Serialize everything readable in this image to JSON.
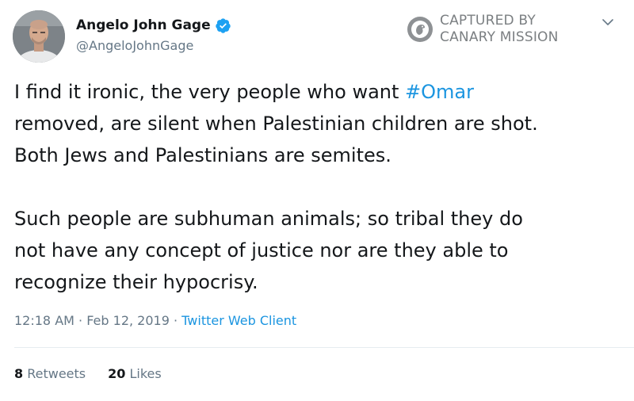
{
  "author": {
    "display_name": "Angelo John Gage",
    "handle": "@AngeloJohnGage",
    "verified": true
  },
  "watermark": {
    "line1": "CAPTURED BY",
    "line2": "CANARY MISSION"
  },
  "tweet": {
    "p1_before": "I find it ironic, the very people who want ",
    "hashtag": "#Omar",
    "p1_line2": "removed, are silent when Palestinian children are shot.",
    "p1_line3": "Both Jews and Palestinians are semites.",
    "p2_line1": "Such people are subhuman animals; so tribal they do",
    "p2_line2": "not have any concept of justice nor are they able to",
    "p2_line3": "recognize their hypocrisy."
  },
  "meta": {
    "time": "12:18 AM",
    "sep1": " · ",
    "date": "Feb 12, 2019",
    "sep2": " · ",
    "client": "Twitter Web Client"
  },
  "stats": {
    "retweets_count": "8",
    "retweets_label": "Retweets",
    "likes_count": "20",
    "likes_label": "Likes"
  },
  "icons": {
    "verified": "verified-badge-icon",
    "more": "chevron-down-icon",
    "watermark_logo": "canary-mission-logo"
  },
  "colors": {
    "link": "#1b95e0",
    "secondary_text": "#657786",
    "primary_text": "#14171a",
    "verified": "#1da1f2"
  }
}
